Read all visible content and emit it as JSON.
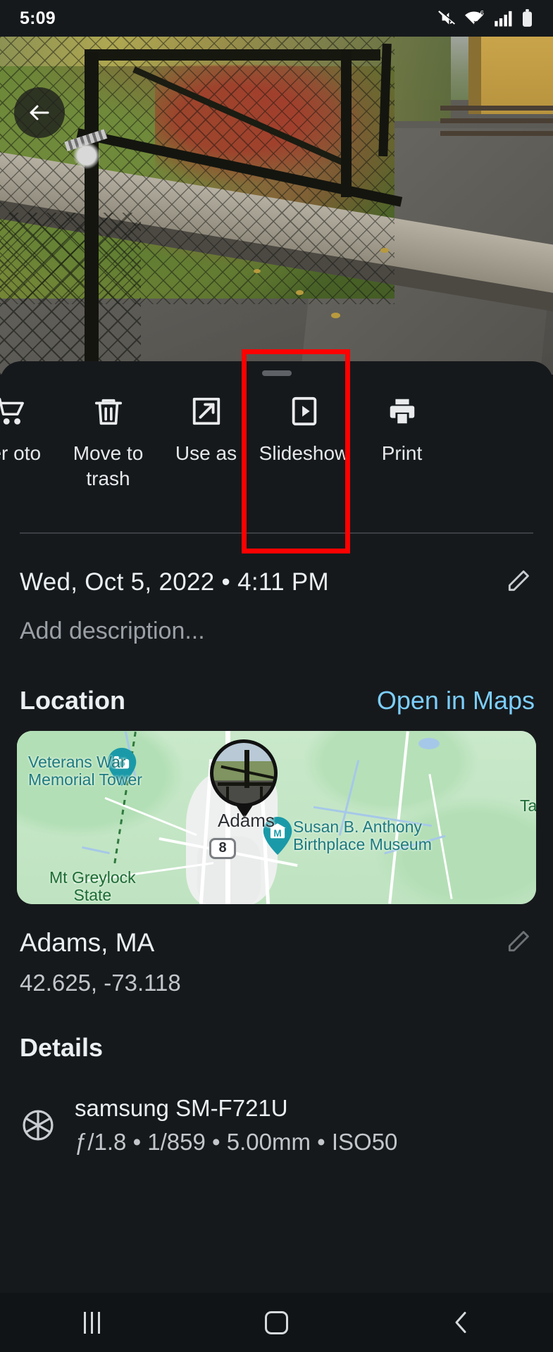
{
  "statusbar": {
    "time": "5:09",
    "icons": [
      "mute-icon",
      "wifi-6-icon",
      "signal-bars-icon",
      "battery-icon"
    ]
  },
  "photo": {
    "back_button": "back-arrow-icon",
    "alt": "Black chain-link gate beside an autumn hedge and a wet road"
  },
  "sheet": {
    "grabber": "drag-handle",
    "actions": [
      {
        "icon": "order-photo-cart-icon",
        "label": "der\noto"
      },
      {
        "icon": "trash-icon",
        "label": "Move to trash"
      },
      {
        "icon": "use-as-icon",
        "label": "Use as"
      },
      {
        "icon": "slideshow-icon",
        "label": "Slideshow"
      },
      {
        "icon": "print-icon",
        "label": "Print"
      }
    ],
    "highlight": {
      "target": "Slideshow",
      "color": "#ff0000"
    }
  },
  "info": {
    "datetime": "Wed, Oct 5, 2022  •  4:11 PM",
    "edit_icon": "pencil-icon",
    "description_placeholder": "Add description..."
  },
  "location": {
    "title": "Location",
    "open_in_maps": "Open in Maps",
    "link_color": "#7ccefd",
    "place": "Adams, MA",
    "coordinates": "42.625, -73.118",
    "edit_icon": "pencil-icon",
    "map_labels": {
      "veterans": "Veterans War\nMemorial Tower",
      "city": "Adams",
      "museum": "Susan B. Anthony\nBirthplace Museum",
      "park": "Mt Greylock\nState",
      "clipped": "Ta",
      "highway_shield": "8"
    }
  },
  "details": {
    "title": "Details",
    "icon": "aperture-icon",
    "camera_model": "samsung SM-F721U",
    "exif": "ƒ/1.8  •  1/859  •  5.00mm  •  ISO50"
  },
  "navbar": {
    "recents": "recents-icon",
    "home": "home-icon",
    "back": "back-chevron-icon"
  }
}
